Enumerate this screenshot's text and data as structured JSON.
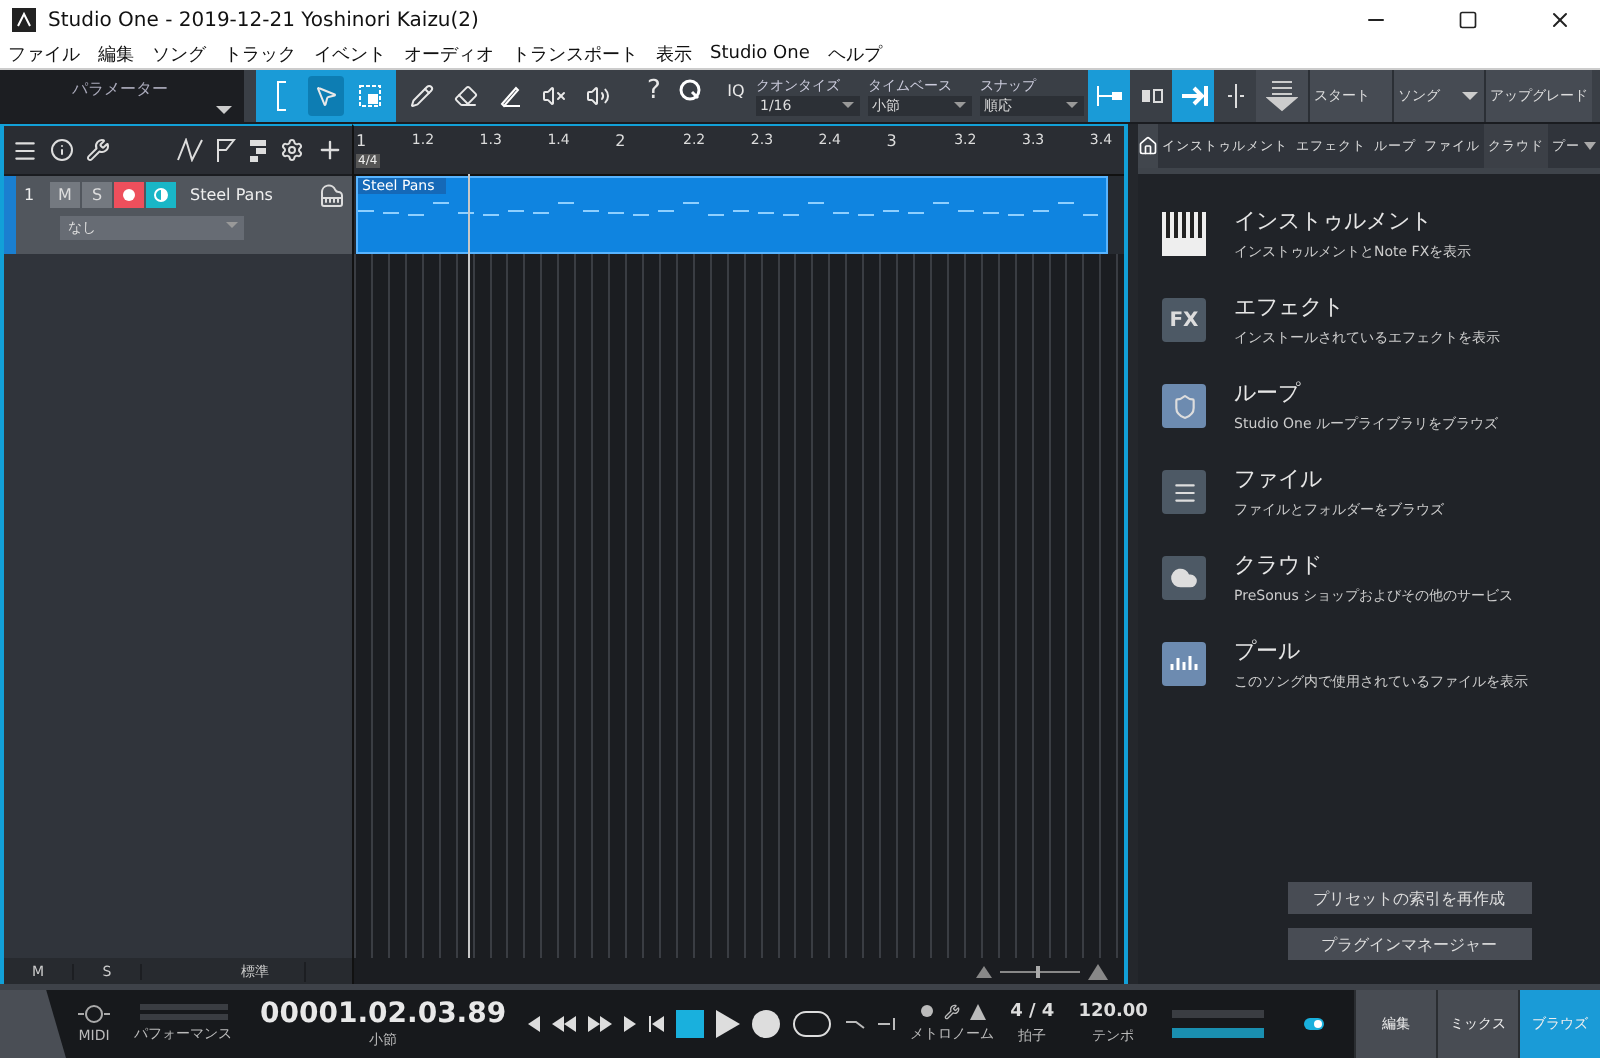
{
  "window": {
    "title": "Studio One - 2019-12-21 Yoshinori Kaizu(2)"
  },
  "menu": [
    "ファイル",
    "編集",
    "ソング",
    "トラック",
    "イベント",
    "オーディオ",
    "トランスポート",
    "表示",
    "Studio One",
    "ヘルプ"
  ],
  "toolbar": {
    "parameter": "パラメーター",
    "tools": [
      {
        "kind": "bracket",
        "selected": false
      },
      {
        "kind": "arrow",
        "selected": true
      },
      {
        "kind": "range",
        "selected": false
      },
      {
        "kind": "pencil",
        "selected": false
      },
      {
        "kind": "eraser",
        "selected": false
      },
      {
        "kind": "paint",
        "selected": false
      },
      {
        "kind": "mute",
        "selected": false
      },
      {
        "kind": "listen",
        "selected": false
      }
    ],
    "help": "?",
    "quantize_icon": "IQ",
    "fields": [
      {
        "label": "クオンタイズ",
        "value": "1/16"
      },
      {
        "label": "タイムベース",
        "value": "小節"
      },
      {
        "label": "スナップ",
        "value": "順応"
      }
    ],
    "toggles": [
      {
        "kind": "loop-start",
        "on": true
      },
      {
        "kind": "split",
        "on": false
      },
      {
        "kind": "follow",
        "on": true
      },
      {
        "kind": "cursor",
        "on": false
      }
    ],
    "start": "スタート",
    "song": "ソング",
    "upgrade": "アップグレード"
  },
  "tracks": [
    {
      "number": "1",
      "mute": "M",
      "solo": "S",
      "armed": true,
      "monitor": true,
      "name": "Steel Pans",
      "input": "なし",
      "clip": "Steel Pans"
    }
  ],
  "ruler": {
    "time_signature": "4/4",
    "labels": [
      "1",
      "1.2",
      "1.3",
      "1.4",
      "2",
      "2.2",
      "2.3",
      "2.4",
      "3",
      "3.2",
      "3.3",
      "3.4"
    ]
  },
  "track_footer": {
    "mute": "M",
    "solo": "S",
    "view": "標準"
  },
  "browser": {
    "tabs": [
      {
        "label": "インストゥルメント",
        "selected": false
      },
      {
        "label": "エフェクト",
        "selected": false
      },
      {
        "label": "ループ",
        "selected": false
      },
      {
        "label": "ファイル",
        "selected": false
      },
      {
        "label": "クラウド",
        "selected": true
      },
      {
        "label": "プー",
        "selected": false
      }
    ],
    "items": [
      {
        "kind": "instrument",
        "title": "インストゥルメント",
        "subtitle": "インストゥルメントとNote FXを表示"
      },
      {
        "kind": "effect",
        "title": "エフェクト",
        "subtitle": "インストールされているエフェクトを表示",
        "icon_text": "FX"
      },
      {
        "kind": "loop",
        "title": "ループ",
        "subtitle": "Studio One ループライブラリをブラウズ"
      },
      {
        "kind": "file",
        "title": "ファイル",
        "subtitle": "ファイルとフォルダーをブラウズ"
      },
      {
        "kind": "cloud",
        "title": "クラウド",
        "subtitle": "PreSonus ショップおよびその他のサービス"
      },
      {
        "kind": "pool",
        "title": "プール",
        "subtitle": "このソング内で使用されているファイルを表示"
      }
    ],
    "buttons": [
      "プリセットの索引を再作成",
      "プラグインマネージャー"
    ]
  },
  "transport": {
    "midi": "MIDI",
    "performance": "パフォーマンス",
    "time": "00001.02.03.89",
    "time_unit": "小節",
    "metronome": "メトロノーム",
    "signature": "4 / 4",
    "signature_label": "拍子",
    "tempo": "120.00",
    "tempo_label": "テンポ",
    "pages": [
      {
        "label": "編集",
        "selected": false
      },
      {
        "label": "ミックス",
        "selected": false
      },
      {
        "label": "ブラウズ",
        "selected": true
      }
    ]
  }
}
